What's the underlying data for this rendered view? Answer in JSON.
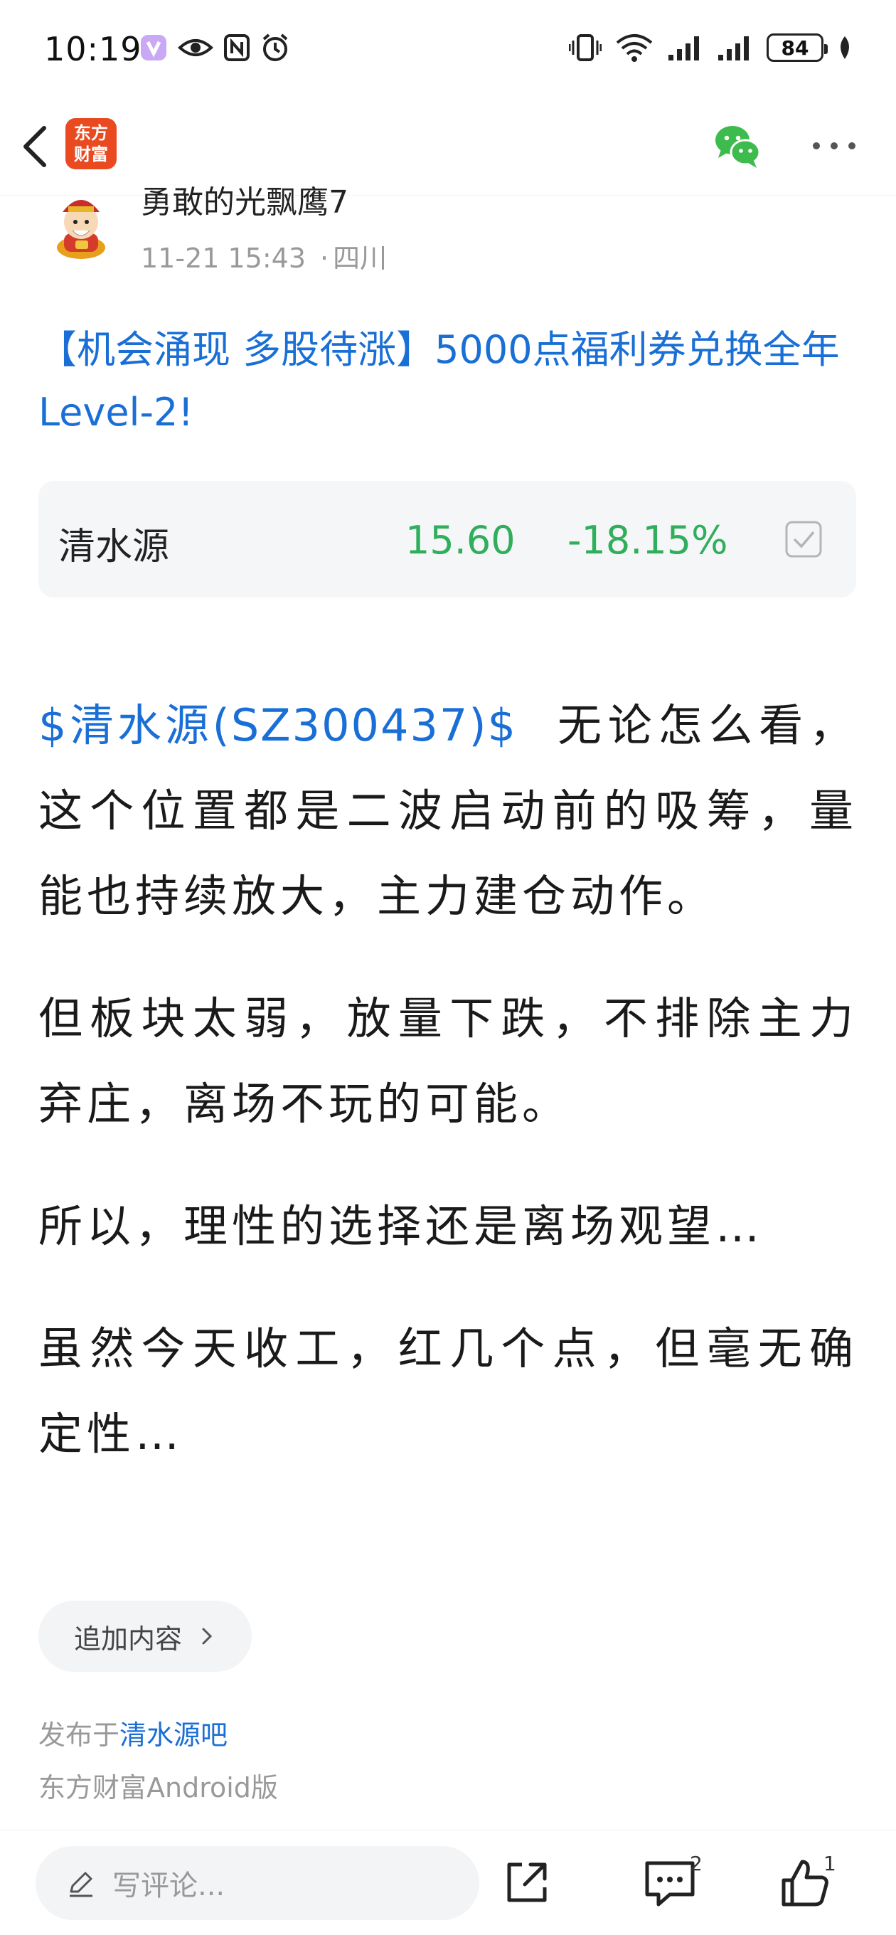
{
  "status_bar": {
    "time": "10:19",
    "battery": "84"
  },
  "nav": {
    "logo_line1": "东方",
    "logo_line2": "财富"
  },
  "author": {
    "name": "勇敢的光飘鹰7",
    "time": "11-21 15:43",
    "location": "四川"
  },
  "promo": {
    "text": "【机会涌现 多股待涨】5000点福利券兑换全年Level-2!"
  },
  "stock_card": {
    "name": "清水源",
    "price": "15.60",
    "change": "-18.15%"
  },
  "article": {
    "stock_tag": "$清水源(SZ300437)$",
    "p1_rest": "无论怎么看，这个位置都是二波启动前的吸筹，量能也持续放大，主力建仓动作。",
    "p2": "但板块太弱，放量下跌，不排除主力弃庄，离场不玩的可能。",
    "p3": "所以，理性的选择还是离场观望…",
    "p4": "虽然今天收工，红几个点，但毫无确定性…"
  },
  "append_button": {
    "label": "追加内容"
  },
  "publish": {
    "prefix": "发布于",
    "bar_name": "清水源吧",
    "client": "东方财富Android版"
  },
  "bottom_bar": {
    "comment_placeholder": "写评论...",
    "comment_count": "2",
    "like_count": "1"
  },
  "colors": {
    "link_blue": "#1a6fd6",
    "stock_green": "#2fae5b",
    "logo_orange": "#ea4a20"
  }
}
